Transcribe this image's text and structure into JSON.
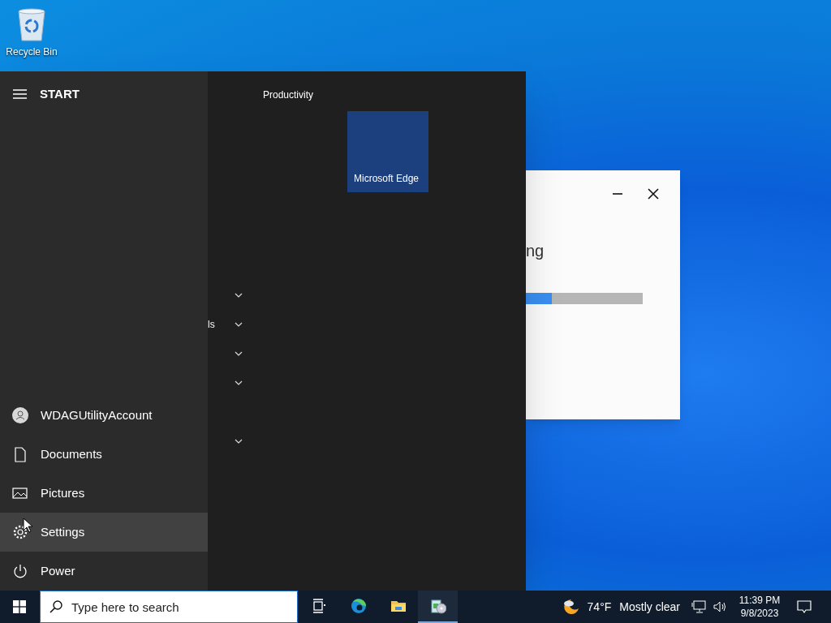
{
  "desktop_icons": [
    {
      "label": "Recycle Bin"
    }
  ],
  "background_window": {
    "text": "ng",
    "progress": {
      "level": 0.22
    }
  },
  "start_menu": {
    "title": "START",
    "rail_items": [
      {
        "kind": "user",
        "label": "WDAGUtilityAccount",
        "selected": false
      },
      {
        "kind": "documents",
        "label": "Documents",
        "selected": false
      },
      {
        "kind": "pictures",
        "label": "Pictures",
        "selected": false
      },
      {
        "kind": "settings",
        "label": "Settings",
        "selected": true
      },
      {
        "kind": "power",
        "label": "Power",
        "selected": false
      }
    ],
    "group_label": "Productivity",
    "tiles": [
      {
        "label": "Microsoft Edge"
      }
    ],
    "list_rows": [
      {
        "kind": "group"
      },
      {
        "kind": "group",
        "label": "ls"
      },
      {
        "kind": "group"
      },
      {
        "kind": "group"
      },
      {
        "kind": "blank"
      },
      {
        "kind": "group"
      }
    ]
  },
  "taskbar": {
    "search": {
      "placeholder": "Type here to search"
    },
    "apps": [
      {
        "kind": "taskview",
        "active": false
      },
      {
        "kind": "edge",
        "active": false
      },
      {
        "kind": "explorer",
        "active": false
      },
      {
        "kind": "setup",
        "active": true
      }
    ],
    "weather": {
      "temp": "74°F",
      "condition": "Mostly clear"
    },
    "time": "11:39 PM",
    "date": "9/8/2023"
  }
}
